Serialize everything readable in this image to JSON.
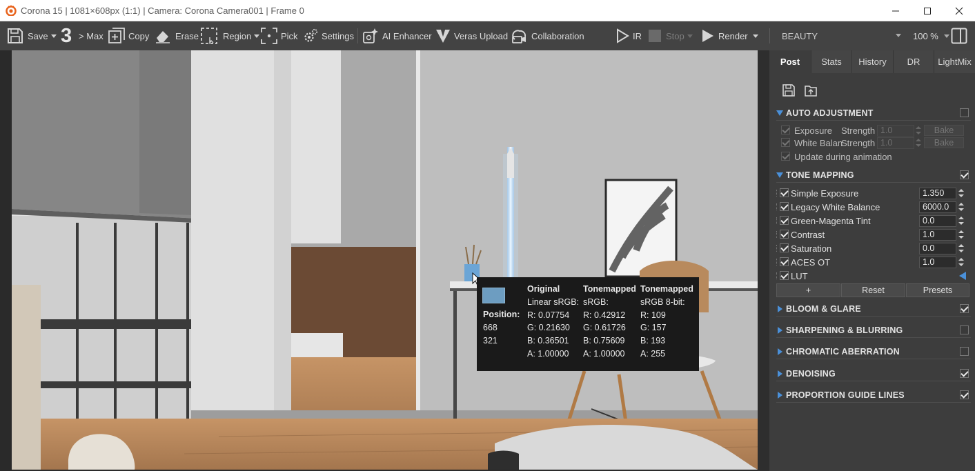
{
  "window": {
    "title": "Corona 15 | 1081×608px (1:1) | Camera: Corona Camera001 | Frame 0",
    "minimize_icon": "minimize-icon",
    "maximize_icon": "maximize-icon",
    "close_icon": "close-icon"
  },
  "toolbar": {
    "save": "Save",
    "max_number": "3",
    "max": "> Max",
    "copy": "Copy",
    "erase": "Erase",
    "region": "Region",
    "pick": "Pick",
    "settings": "Settings",
    "ai_enhancer": "AI Enhancer",
    "veras_upload": "Veras Upload",
    "collaboration": "Collaboration",
    "ir": "IR",
    "stop": "Stop",
    "render": "Render",
    "channel": "BEAUTY",
    "zoom": "100 %"
  },
  "tooltip": {
    "swatch_color": "#6d9dc1",
    "position_label": "Position:",
    "pos_x": "668",
    "pos_y": "321",
    "original_header": "Original",
    "original_sub": "Linear sRGB:",
    "original_r": "R: 0.07754",
    "original_g": "G: 0.21630",
    "original_b": "B: 0.36501",
    "original_a": "A: 1.00000",
    "tm_header": "Tonemapped",
    "tm_sub": "sRGB:",
    "tm_r": "R: 0.42912",
    "tm_g": "G: 0.61726",
    "tm_b": "B: 0.75609",
    "tm_a": "A: 1.00000",
    "tm8_header": "Tonemapped",
    "tm8_sub": "sRGB 8-bit:",
    "tm8_r": "R: 109",
    "tm8_g": "G: 157",
    "tm8_b": "B: 193",
    "tm8_a": "A: 255"
  },
  "panel": {
    "tabs": [
      "Post",
      "Stats",
      "History",
      "DR",
      "LightMix"
    ],
    "active_tab": "Post",
    "auto_adjustment": {
      "title": "AUTO ADJUSTMENT",
      "enabled": false,
      "exposure_label": "Exposure",
      "white_balance_label": "White Balan",
      "strength_label": "Strength",
      "exposure_strength": "1.0",
      "wb_strength": "1.0",
      "bake": "Bake",
      "update_label": "Update during animation"
    },
    "tone_mapping": {
      "title": "TONE MAPPING",
      "enabled": true,
      "rows": [
        {
          "label": "Simple Exposure",
          "value": "1.350"
        },
        {
          "label": "Legacy White Balance",
          "value": "6000.0"
        },
        {
          "label": "Green-Magenta Tint",
          "value": "0.0"
        },
        {
          "label": "Contrast",
          "value": "1.0"
        },
        {
          "label": "Saturation",
          "value": "0.0"
        },
        {
          "label": "ACES OT",
          "value": "1.0"
        }
      ],
      "lut_label": "LUT",
      "add_button": "+",
      "reset_button": "Reset",
      "presets_button": "Presets"
    },
    "sections": [
      {
        "title": "BLOOM & GLARE",
        "enabled": true
      },
      {
        "title": "SHARPENING & BLURRING",
        "enabled": false
      },
      {
        "title": "CHROMATIC ABERRATION",
        "enabled": false
      },
      {
        "title": "DENOISING",
        "enabled": true
      },
      {
        "title": "PROPORTION GUIDE LINES",
        "enabled": true
      }
    ]
  }
}
